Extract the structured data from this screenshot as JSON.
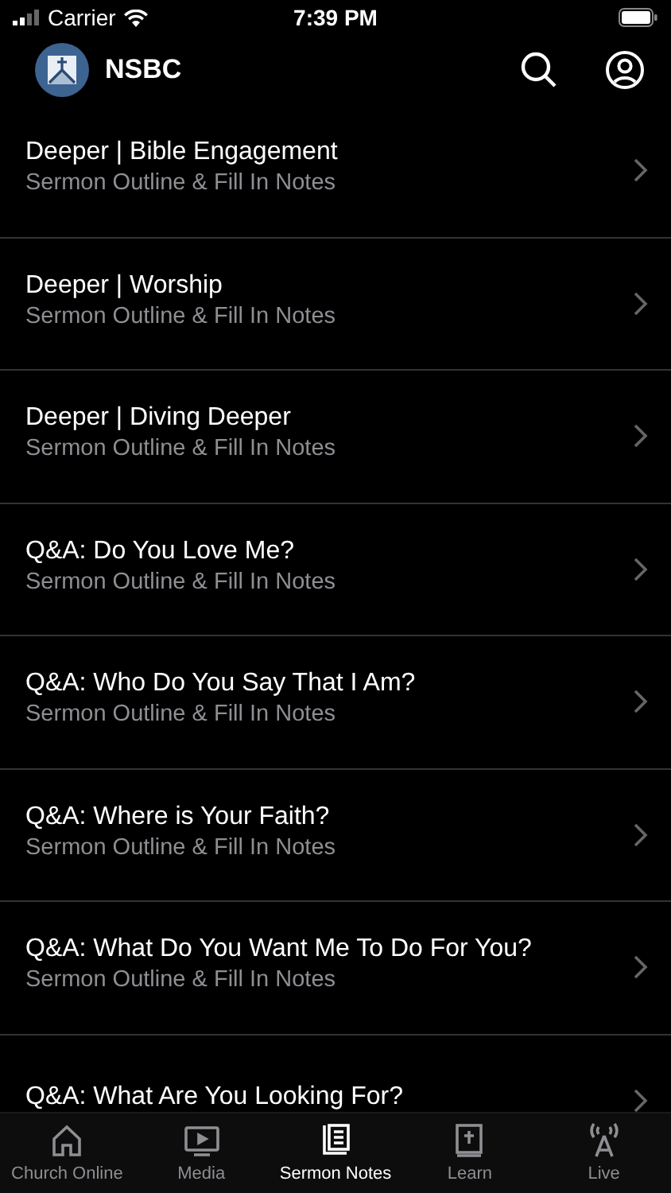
{
  "status_bar": {
    "carrier": "Carrier",
    "time": "7:39 PM"
  },
  "header": {
    "title": "NSBC"
  },
  "items": [
    {
      "title": "Deeper | Bible Engagement",
      "subtitle": "Sermon Outline & Fill In Notes"
    },
    {
      "title": "Deeper | Worship",
      "subtitle": "Sermon Outline & Fill In Notes"
    },
    {
      "title": "Deeper | Diving Deeper",
      "subtitle": "Sermon Outline & Fill In Notes"
    },
    {
      "title": "Q&A: Do You Love Me?",
      "subtitle": "Sermon Outline & Fill In Notes"
    },
    {
      "title": "Q&A: Who Do You Say That I Am?",
      "subtitle": "Sermon Outline & Fill In Notes"
    },
    {
      "title": "Q&A: Where is Your Faith?",
      "subtitle": "Sermon Outline & Fill In Notes"
    },
    {
      "title": "Q&A: What Do You Want Me To Do For You?",
      "subtitle": "Sermon Outline & Fill In Notes"
    },
    {
      "title": "Q&A: What Are You Looking For?"
    }
  ],
  "tabs": [
    {
      "label": "Church Online",
      "kind": "home",
      "selected": false
    },
    {
      "label": "Media",
      "kind": "media",
      "selected": false
    },
    {
      "label": "Sermon Notes",
      "kind": "notes",
      "selected": true
    },
    {
      "label": "Learn",
      "kind": "learn",
      "selected": false
    },
    {
      "label": "Live",
      "kind": "live",
      "selected": false
    }
  ]
}
